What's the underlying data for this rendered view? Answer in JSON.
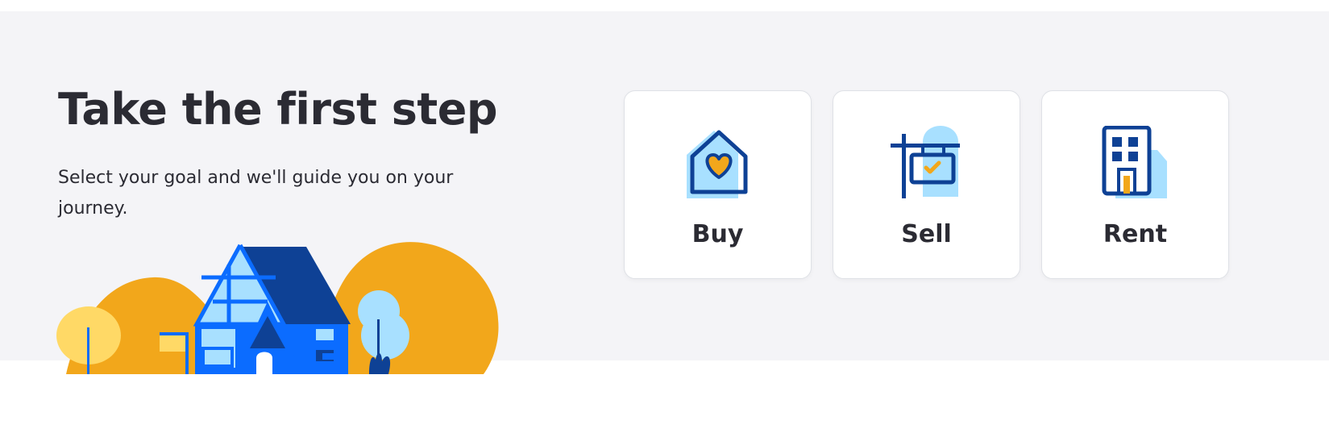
{
  "hero": {
    "title": "Take the first step",
    "subtitle": "Select your goal and we'll guide you on your journey."
  },
  "goals": [
    {
      "label": "Buy",
      "icon": "house-heart-icon"
    },
    {
      "label": "Sell",
      "icon": "sale-sign-icon"
    },
    {
      "label": "Rent",
      "icon": "apartment-building-icon"
    }
  ],
  "colors": {
    "background_band": "#f4f4f7",
    "text": "#2b2b33",
    "brand_blue": "#0e4195",
    "bright_blue": "#0b6cff",
    "light_blue": "#a8e0ff",
    "orange": "#f2a71b",
    "yellow": "#ffd966"
  }
}
